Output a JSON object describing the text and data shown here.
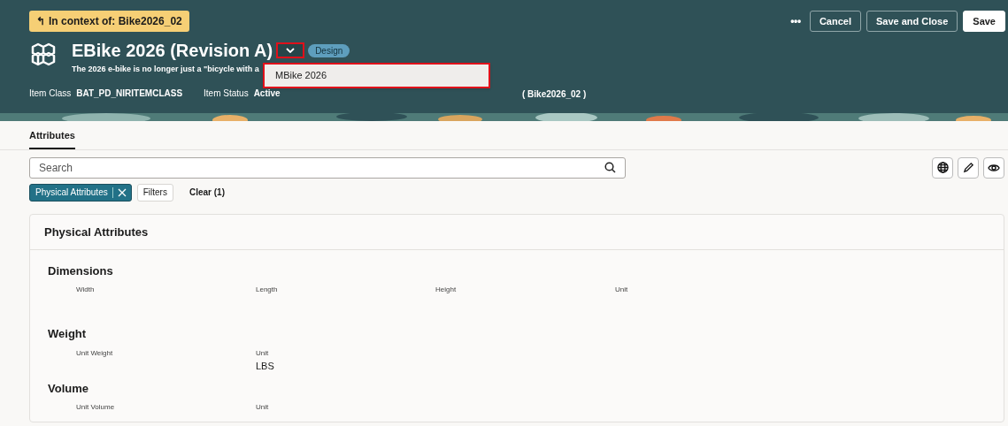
{
  "context_badge": {
    "icon": "↰",
    "label": "In context of: Bike2026_02"
  },
  "header_actions": {
    "more": "•••",
    "buttons": [
      {
        "label": "Cancel",
        "kind": "outline"
      },
      {
        "label": "Save and Close",
        "kind": "outline"
      },
      {
        "label": "Save",
        "kind": "primary"
      }
    ]
  },
  "item": {
    "title": "EBike 2026 (Revision A)",
    "status_badge": "Design",
    "description": "The 2026 e-bike is no longer just a \"bicycle with a",
    "revision_menu": {
      "expanded": true,
      "options": [
        "MBike 2026"
      ]
    }
  },
  "meta": [
    {
      "label": "Item Class",
      "value": "BAT_PD_NIRITEMCLASS"
    },
    {
      "label": "Item Status",
      "value": "Active"
    }
  ],
  "meta_tail": "( Bike2026_02 )",
  "tabs": [
    {
      "label": "Attributes",
      "selected": true
    }
  ],
  "search": {
    "placeholder": "Search"
  },
  "filters": [
    {
      "label": "Physical Attributes",
      "kind": "chip"
    },
    {
      "label": "Filters",
      "kind": "button"
    },
    {
      "label": "Clear (1)",
      "kind": "link"
    }
  ],
  "panel": {
    "title": "Physical Attributes",
    "groups": [
      {
        "title": "Dimensions",
        "fields": [
          {
            "label": "Width"
          },
          {
            "label": "Length"
          },
          {
            "label": "Height"
          },
          {
            "label": "Unit"
          }
        ]
      },
      {
        "title": "Weight",
        "fields": [
          {
            "label": "Unit Weight"
          },
          {
            "label": "Unit",
            "value": "LBS"
          }
        ]
      },
      {
        "title": "Volume",
        "fields": [
          {
            "label": "Unit Volume"
          },
          {
            "label": "Unit"
          }
        ]
      }
    ]
  }
}
